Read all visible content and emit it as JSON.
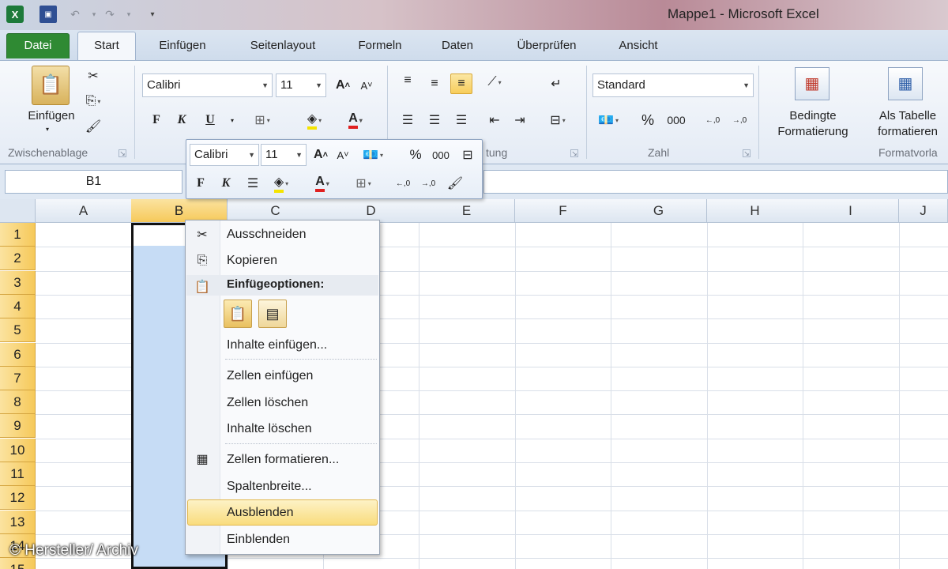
{
  "window": {
    "title": "Mappe1  -  Microsoft Excel"
  },
  "tabs": [
    "Datei",
    "Start",
    "Einfügen",
    "Seitenlayout",
    "Formeln",
    "Daten",
    "Überprüfen",
    "Ansicht"
  ],
  "ribbon": {
    "clipboard": {
      "paste_label": "Einfügen",
      "group_label": "Zwischenablage"
    },
    "font": {
      "family": "Calibri",
      "size": "11",
      "bold": "F",
      "italic": "K",
      "underline": "U"
    },
    "alignment": {
      "group_label_partial": "tung"
    },
    "number": {
      "format": "Standard",
      "group_label": "Zahl",
      "percent": "%",
      "thousands": "000"
    },
    "styles": {
      "conditional_label_1": "Bedingte",
      "conditional_label_2": "Formatierung",
      "table_label_1": "Als Tabelle",
      "table_label_2": "formatieren",
      "group_label_partial": "Formatvorla"
    }
  },
  "mini_toolbar": {
    "font": "Calibri",
    "size": "11",
    "percent": "%",
    "thousands": "000",
    "bold": "F",
    "italic": "K"
  },
  "formula_bar": {
    "name_box": "B1"
  },
  "grid": {
    "columns": [
      "A",
      "B",
      "C",
      "D",
      "E",
      "F",
      "G",
      "H",
      "I",
      "J"
    ],
    "rows": [
      "1",
      "2",
      "3",
      "4",
      "5",
      "6",
      "7",
      "8",
      "9",
      "10",
      "11",
      "12",
      "13",
      "14",
      "15"
    ],
    "selected_column": "B"
  },
  "context_menu": {
    "cut": "Ausschneiden",
    "copy": "Kopieren",
    "paste_options_header": "Einfügeoptionen:",
    "paste_special": "Inhalte einfügen...",
    "insert_cells": "Zellen einfügen",
    "delete_cells": "Zellen löschen",
    "clear_contents": "Inhalte löschen",
    "format_cells": "Zellen formatieren...",
    "column_width": "Spaltenbreite...",
    "hide": "Ausblenden",
    "unhide": "Einblenden"
  },
  "colors": {
    "selection": "#c6dcf5",
    "header_selected": "#f6c95a",
    "file_tab": "#2f8a33",
    "highlight": "#f9dc7d"
  },
  "watermark": "© Hersteller/ Archiv"
}
